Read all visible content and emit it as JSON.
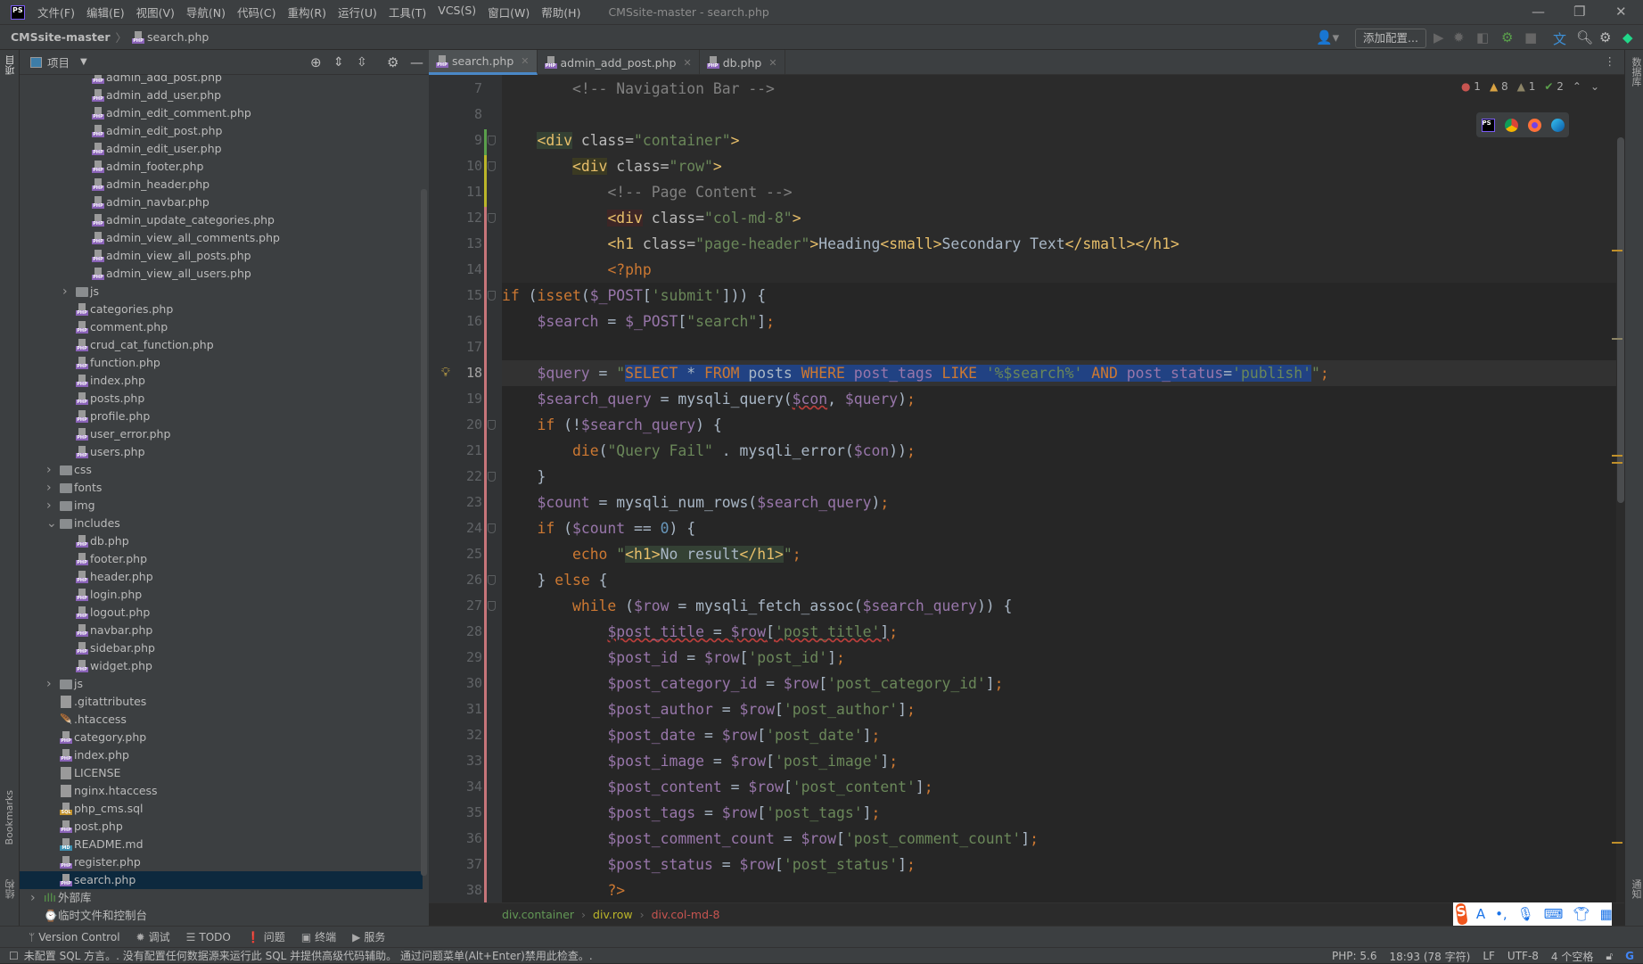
{
  "menubar": {
    "app_icon": "PS",
    "items": [
      "文件(F)",
      "编辑(E)",
      "视图(V)",
      "导航(N)",
      "代码(C)",
      "重构(R)",
      "运行(U)",
      "工具(T)",
      "VCS(S)",
      "窗口(W)",
      "帮助(H)"
    ],
    "title": "CMSsite-master - search.php"
  },
  "navbar": {
    "project": "CMSsite-master",
    "file": "search.php",
    "add_config": "添加配置..."
  },
  "project_panel": {
    "title": "项目",
    "items": [
      {
        "label": "admin_add_post.php",
        "kind": "php",
        "depth": 3
      },
      {
        "label": "admin_add_user.php",
        "kind": "php",
        "depth": 3
      },
      {
        "label": "admin_edit_comment.php",
        "kind": "php",
        "depth": 3
      },
      {
        "label": "admin_edit_post.php",
        "kind": "php",
        "depth": 3
      },
      {
        "label": "admin_edit_user.php",
        "kind": "php",
        "depth": 3
      },
      {
        "label": "admin_footer.php",
        "kind": "php",
        "depth": 3
      },
      {
        "label": "admin_header.php",
        "kind": "php",
        "depth": 3
      },
      {
        "label": "admin_navbar.php",
        "kind": "php",
        "depth": 3
      },
      {
        "label": "admin_update_categories.php",
        "kind": "php",
        "depth": 3
      },
      {
        "label": "admin_view_all_comments.php",
        "kind": "php",
        "depth": 3
      },
      {
        "label": "admin_view_all_posts.php",
        "kind": "php",
        "depth": 3
      },
      {
        "label": "admin_view_all_users.php",
        "kind": "php",
        "depth": 3
      },
      {
        "label": "js",
        "kind": "folder",
        "depth": 2,
        "expanded": false
      },
      {
        "label": "categories.php",
        "kind": "php",
        "depth": 2
      },
      {
        "label": "comment.php",
        "kind": "php",
        "depth": 2
      },
      {
        "label": "crud_cat_function.php",
        "kind": "php",
        "depth": 2
      },
      {
        "label": "function.php",
        "kind": "php",
        "depth": 2
      },
      {
        "label": "index.php",
        "kind": "php",
        "depth": 2
      },
      {
        "label": "posts.php",
        "kind": "php",
        "depth": 2
      },
      {
        "label": "profile.php",
        "kind": "php",
        "depth": 2
      },
      {
        "label": "user_error.php",
        "kind": "php",
        "depth": 2
      },
      {
        "label": "users.php",
        "kind": "php",
        "depth": 2
      },
      {
        "label": "css",
        "kind": "folder",
        "depth": 1,
        "expanded": false
      },
      {
        "label": "fonts",
        "kind": "folder",
        "depth": 1,
        "expanded": false
      },
      {
        "label": "img",
        "kind": "folder",
        "depth": 1,
        "expanded": false
      },
      {
        "label": "includes",
        "kind": "folder",
        "depth": 1,
        "expanded": true
      },
      {
        "label": "db.php",
        "kind": "php",
        "depth": 2
      },
      {
        "label": "footer.php",
        "kind": "php",
        "depth": 2
      },
      {
        "label": "header.php",
        "kind": "php",
        "depth": 2
      },
      {
        "label": "login.php",
        "kind": "php",
        "depth": 2
      },
      {
        "label": "logout.php",
        "kind": "php",
        "depth": 2
      },
      {
        "label": "navbar.php",
        "kind": "php",
        "depth": 2
      },
      {
        "label": "sidebar.php",
        "kind": "php",
        "depth": 2
      },
      {
        "label": "widget.php",
        "kind": "php",
        "depth": 2
      },
      {
        "label": "js",
        "kind": "folder",
        "depth": 1,
        "expanded": false
      },
      {
        "label": ".gitattributes",
        "kind": "text",
        "depth": 1
      },
      {
        "label": ".htaccess",
        "kind": "apache",
        "depth": 1
      },
      {
        "label": "category.php",
        "kind": "php",
        "depth": 1
      },
      {
        "label": "index.php",
        "kind": "php",
        "depth": 1
      },
      {
        "label": "LICENSE",
        "kind": "text",
        "depth": 1
      },
      {
        "label": "nginx.htaccess",
        "kind": "text",
        "depth": 1
      },
      {
        "label": "php_cms.sql",
        "kind": "sql",
        "depth": 1
      },
      {
        "label": "post.php",
        "kind": "php",
        "depth": 1
      },
      {
        "label": "README.md",
        "kind": "md",
        "depth": 1
      },
      {
        "label": "register.php",
        "kind": "php",
        "depth": 1
      },
      {
        "label": "search.php",
        "kind": "php",
        "depth": 1,
        "selected": true
      },
      {
        "label": "外部库",
        "kind": "library",
        "depth": 0,
        "expanded": false
      },
      {
        "label": "临时文件和控制台",
        "kind": "scratch",
        "depth": 0
      }
    ]
  },
  "left_strip": {
    "project": "项目",
    "bookmarks": "Bookmarks",
    "structure": "结构"
  },
  "right_strip": {
    "database": "数据库",
    "notifications": "通知"
  },
  "tabs": [
    {
      "label": "search.php",
      "active": true
    },
    {
      "label": "admin_add_post.php"
    },
    {
      "label": "db.php"
    }
  ],
  "inspections": {
    "errors": "1",
    "warnings": "8",
    "weak_warnings": "1",
    "typos": "2"
  },
  "editor": {
    "current_line": 18,
    "lines": [
      {
        "n": 7,
        "indent": 8,
        "tokens": [
          [
            "c",
            "<!-- Navigation Bar -->"
          ]
        ]
      },
      {
        "n": 8,
        "indent": 0,
        "tokens": []
      },
      {
        "n": 9,
        "indent": 4,
        "tokens": [
          [
            "t hg",
            "<div"
          ],
          [
            "a",
            " class="
          ],
          [
            "s",
            "\"container\""
          ],
          [
            "t",
            ">"
          ]
        ]
      },
      {
        "n": 10,
        "indent": 8,
        "tokens": [
          [
            "t hy",
            "<div"
          ],
          [
            "a",
            " class="
          ],
          [
            "s",
            "\"row\""
          ],
          [
            "t",
            ">"
          ]
        ]
      },
      {
        "n": 11,
        "indent": 12,
        "tokens": [
          [
            "c",
            "<!-- Page Content -->"
          ]
        ]
      },
      {
        "n": 12,
        "indent": 12,
        "tokens": [
          [
            "t hr",
            "<div"
          ],
          [
            "a",
            " class="
          ],
          [
            "s",
            "\"col-md-8\""
          ],
          [
            "t",
            ">"
          ]
        ]
      },
      {
        "n": 13,
        "indent": 12,
        "tokens": [
          [
            "t",
            "<h1"
          ],
          [
            "a",
            " class="
          ],
          [
            "s",
            "\"page-header\""
          ],
          [
            "t",
            ">"
          ],
          [
            "p",
            "Heading"
          ],
          [
            "t",
            "<small>"
          ],
          [
            "p",
            "Secondary Text"
          ],
          [
            "t",
            "</small></h1>"
          ]
        ]
      },
      {
        "n": 14,
        "indent": 12,
        "tokens": [
          [
            "k",
            "<?php"
          ]
        ]
      },
      {
        "n": 15,
        "indent": 0,
        "tokens": [
          [
            "k",
            "if "
          ],
          [
            "p",
            "("
          ],
          [
            "k",
            "isset"
          ],
          [
            "p",
            "("
          ],
          [
            "v",
            "$_POST"
          ],
          [
            "p",
            "["
          ],
          [
            "s",
            "'submit'"
          ],
          [
            "p",
            "])) {"
          ]
        ]
      },
      {
        "n": 16,
        "indent": 4,
        "tokens": [
          [
            "v",
            "$search"
          ],
          [
            "p",
            " = "
          ],
          [
            "v",
            "$_POST"
          ],
          [
            "p",
            "["
          ],
          [
            "s",
            "\"search\""
          ],
          [
            "p",
            "]"
          ],
          [
            "k",
            ";"
          ]
        ]
      },
      {
        "n": 17,
        "indent": 0,
        "tokens": []
      },
      {
        "n": 18,
        "indent": 4,
        "tokens": [
          [
            "v",
            "$query"
          ],
          [
            "p",
            " = "
          ],
          [
            "s",
            "\""
          ],
          [
            "k sel",
            "SELECT "
          ],
          [
            "p sel",
            "* "
          ],
          [
            "k sel",
            "FROM "
          ],
          [
            "p sel",
            "posts "
          ],
          [
            "k sel",
            "WHERE "
          ],
          [
            "v sel",
            "post_tags "
          ],
          [
            "k sel",
            "LIKE "
          ],
          [
            "s sel",
            "'%$search%' "
          ],
          [
            "k sel",
            "AND "
          ],
          [
            "v sel",
            "post_status"
          ],
          [
            "p sel",
            "="
          ],
          [
            "s sel",
            "'publish'"
          ],
          [
            "s",
            "\""
          ],
          [
            "k",
            ";"
          ]
        ]
      },
      {
        "n": 19,
        "indent": 4,
        "tokens": [
          [
            "v",
            "$search_query"
          ],
          [
            "p",
            " = mysqli_query("
          ],
          [
            "v wave",
            "$con"
          ],
          [
            "p",
            ", "
          ],
          [
            "v",
            "$query"
          ],
          [
            "p",
            ")"
          ],
          [
            "k",
            ";"
          ]
        ]
      },
      {
        "n": 20,
        "indent": 4,
        "tokens": [
          [
            "k",
            "if "
          ],
          [
            "p",
            "(!"
          ],
          [
            "v",
            "$search_query"
          ],
          [
            "p",
            ") {"
          ]
        ]
      },
      {
        "n": 21,
        "indent": 8,
        "tokens": [
          [
            "k",
            "die"
          ],
          [
            "p",
            "("
          ],
          [
            "s",
            "\"Query Fail\""
          ],
          [
            "p",
            " . mysqli_error("
          ],
          [
            "v",
            "$con"
          ],
          [
            "p",
            "))"
          ],
          [
            "k",
            ";"
          ]
        ]
      },
      {
        "n": 22,
        "indent": 4,
        "tokens": [
          [
            "p",
            "}"
          ]
        ]
      },
      {
        "n": 23,
        "indent": 4,
        "tokens": [
          [
            "v",
            "$count"
          ],
          [
            "p",
            " = mysqli_num_rows("
          ],
          [
            "v",
            "$search_query"
          ],
          [
            "p",
            ")"
          ],
          [
            "k",
            ";"
          ]
        ]
      },
      {
        "n": 24,
        "indent": 4,
        "tokens": [
          [
            "k",
            "if "
          ],
          [
            "p",
            "("
          ],
          [
            "v",
            "$count"
          ],
          [
            "p",
            " == "
          ],
          [
            "n",
            "0"
          ],
          [
            "p",
            ") {"
          ]
        ]
      },
      {
        "n": 25,
        "indent": 8,
        "tokens": [
          [
            "k",
            "echo "
          ],
          [
            "s",
            "\""
          ],
          [
            "t hh",
            "<h1>"
          ],
          [
            "p hh",
            "No result"
          ],
          [
            "t hh",
            "</h1>"
          ],
          [
            "s",
            "\""
          ],
          [
            "k",
            ";"
          ]
        ]
      },
      {
        "n": 26,
        "indent": 4,
        "tokens": [
          [
            "p",
            "} "
          ],
          [
            "k",
            "else "
          ],
          [
            "p",
            "{"
          ]
        ]
      },
      {
        "n": 27,
        "indent": 8,
        "tokens": [
          [
            "k",
            "while "
          ],
          [
            "p",
            "("
          ],
          [
            "v",
            "$row"
          ],
          [
            "p",
            " = mysqli_fetch_assoc("
          ],
          [
            "v",
            "$search_query"
          ],
          [
            "p",
            ")) {"
          ]
        ]
      },
      {
        "n": 28,
        "indent": 12,
        "tokens": [
          [
            "v wave",
            "$post_title"
          ],
          [
            "p wave",
            " = "
          ],
          [
            "v wave",
            "$row"
          ],
          [
            "p wave",
            "["
          ],
          [
            "s wave",
            "'post_title'"
          ],
          [
            "p wave",
            "]"
          ],
          [
            "k",
            ";"
          ]
        ]
      },
      {
        "n": 29,
        "indent": 12,
        "tokens": [
          [
            "v",
            "$post_id"
          ],
          [
            "p",
            " = "
          ],
          [
            "v",
            "$row"
          ],
          [
            "p",
            "["
          ],
          [
            "s",
            "'post_id'"
          ],
          [
            "p",
            "]"
          ],
          [
            "k",
            ";"
          ]
        ]
      },
      {
        "n": 30,
        "indent": 12,
        "tokens": [
          [
            "v",
            "$post_category_id"
          ],
          [
            "p",
            " = "
          ],
          [
            "v",
            "$row"
          ],
          [
            "p",
            "["
          ],
          [
            "s",
            "'post_category_id'"
          ],
          [
            "p",
            "]"
          ],
          [
            "k",
            ";"
          ]
        ]
      },
      {
        "n": 31,
        "indent": 12,
        "tokens": [
          [
            "v",
            "$post_author"
          ],
          [
            "p",
            " = "
          ],
          [
            "v",
            "$row"
          ],
          [
            "p",
            "["
          ],
          [
            "s",
            "'post_author'"
          ],
          [
            "p",
            "]"
          ],
          [
            "k",
            ";"
          ]
        ]
      },
      {
        "n": 32,
        "indent": 12,
        "tokens": [
          [
            "v",
            "$post_date"
          ],
          [
            "p",
            " = "
          ],
          [
            "v",
            "$row"
          ],
          [
            "p",
            "["
          ],
          [
            "s",
            "'post_date'"
          ],
          [
            "p",
            "]"
          ],
          [
            "k",
            ";"
          ]
        ]
      },
      {
        "n": 33,
        "indent": 12,
        "tokens": [
          [
            "v",
            "$post_image"
          ],
          [
            "p",
            " = "
          ],
          [
            "v",
            "$row"
          ],
          [
            "p",
            "["
          ],
          [
            "s",
            "'post_image'"
          ],
          [
            "p",
            "]"
          ],
          [
            "k",
            ";"
          ]
        ]
      },
      {
        "n": 34,
        "indent": 12,
        "tokens": [
          [
            "v",
            "$post_content"
          ],
          [
            "p",
            " = "
          ],
          [
            "v",
            "$row"
          ],
          [
            "p",
            "["
          ],
          [
            "s",
            "'post_content'"
          ],
          [
            "p",
            "]"
          ],
          [
            "k",
            ";"
          ]
        ]
      },
      {
        "n": 35,
        "indent": 12,
        "tokens": [
          [
            "v",
            "$post_tags"
          ],
          [
            "p",
            " = "
          ],
          [
            "v",
            "$row"
          ],
          [
            "p",
            "["
          ],
          [
            "s",
            "'post_tags'"
          ],
          [
            "p",
            "]"
          ],
          [
            "k",
            ";"
          ]
        ]
      },
      {
        "n": 36,
        "indent": 12,
        "tokens": [
          [
            "v",
            "$post_comment_count"
          ],
          [
            "p",
            " = "
          ],
          [
            "v",
            "$row"
          ],
          [
            "p",
            "["
          ],
          [
            "s",
            "'post_comment_count'"
          ],
          [
            "p",
            "]"
          ],
          [
            "k",
            ";"
          ]
        ]
      },
      {
        "n": 37,
        "indent": 12,
        "tokens": [
          [
            "v",
            "$post_status"
          ],
          [
            "p",
            " = "
          ],
          [
            "v",
            "$row"
          ],
          [
            "p",
            "["
          ],
          [
            "s",
            "'post_status'"
          ],
          [
            "p",
            "]"
          ],
          [
            "k",
            ";"
          ]
        ]
      },
      {
        "n": 38,
        "indent": 12,
        "tokens": [
          [
            "k",
            "?>"
          ]
        ]
      }
    ]
  },
  "breadcrumb": [
    "div.container",
    "div.row",
    "div.col-md-8"
  ],
  "breadcrumb_colors": [
    "#629755",
    "#BBB529",
    "#C75450"
  ],
  "toolwindows": [
    "Version Control",
    "调试",
    "TODO",
    "问题",
    "终端",
    "服务"
  ],
  "status": {
    "message": "未配置 SQL 方言。. 没有配置任何数据源来运行此 SQL 并提供高级代码辅助。 通过问题菜单(Alt+Enter)禁用此检查。.",
    "php": "PHP: 5.6",
    "position": "18:93 (78 字符)",
    "line_sep": "LF",
    "encoding": "UTF-8",
    "indent": "4 个空格"
  },
  "ime": {
    "logo": "S",
    "mode": "A",
    "punct": "•,"
  }
}
